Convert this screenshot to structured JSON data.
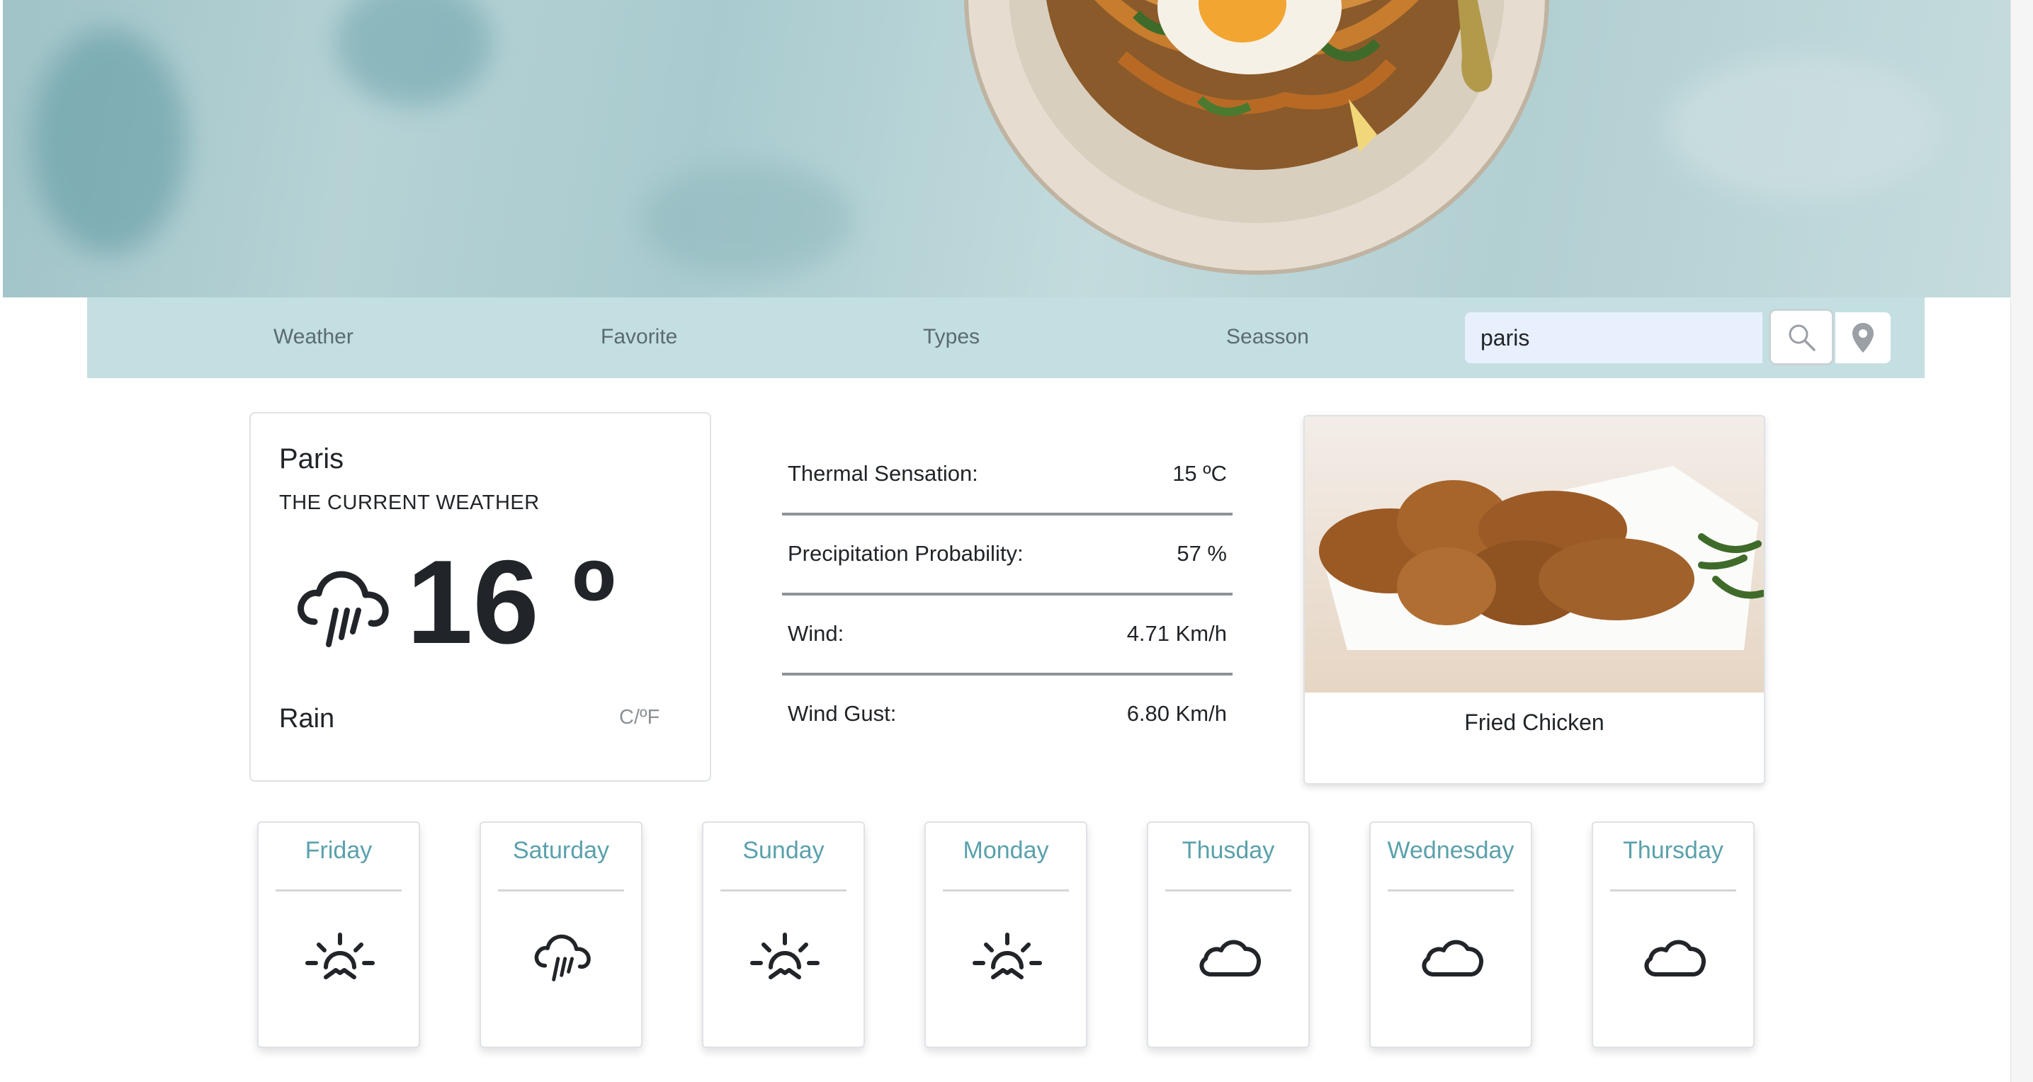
{
  "nav": {
    "items": [
      {
        "label": "Weather"
      },
      {
        "label": "Favorite"
      },
      {
        "label": "Types"
      },
      {
        "label": "Seasson"
      }
    ],
    "search_value": "paris",
    "search_icon": "search-icon",
    "location_icon": "map-pin-icon"
  },
  "current": {
    "city": "Paris",
    "label": "THE CURRENT WEATHER",
    "temperature": "16 º",
    "condition": "Rain",
    "unit_toggle": "C/ºF",
    "icon": "rain-cloud-icon"
  },
  "details": [
    {
      "label": "Thermal Sensation:",
      "value": "15 ºC"
    },
    {
      "label": "Precipitation Probability:",
      "value": "57 %"
    },
    {
      "label": "Wind:",
      "value": "4.71 Km/h"
    },
    {
      "label": "Wind Gust:",
      "value": "6.80 Km/h"
    }
  ],
  "recipe": {
    "name": "Fried Chicken"
  },
  "forecast": [
    {
      "day": "Friday",
      "icon": "sunrise-icon"
    },
    {
      "day": "Saturday",
      "icon": "rain-cloud-icon"
    },
    {
      "day": "Sunday",
      "icon": "sunrise-icon"
    },
    {
      "day": "Monday",
      "icon": "sunrise-icon"
    },
    {
      "day": "Thusday",
      "icon": "cloud-icon"
    },
    {
      "day": "Wednesday",
      "icon": "cloud-icon"
    },
    {
      "day": "Thursday",
      "icon": "cloud-icon"
    }
  ],
  "colors": {
    "navbar": "#c4dfe1",
    "day_accent": "#5aa1ac",
    "search_field": "#e8f0fe"
  }
}
